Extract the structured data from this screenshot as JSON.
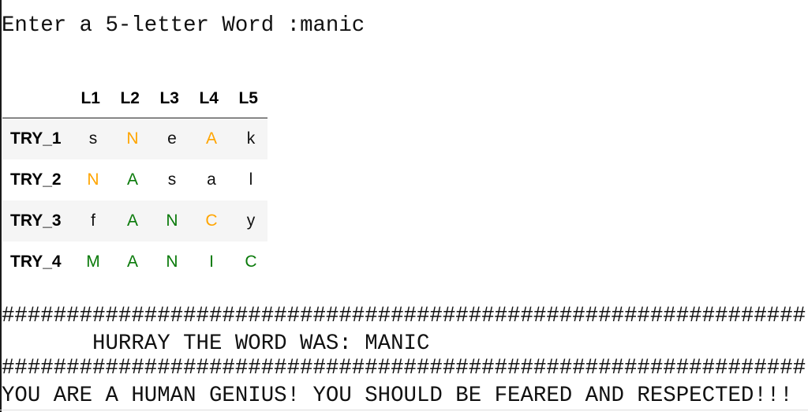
{
  "prompt": {
    "label": "Enter a 5-letter Word :",
    "value": "manic"
  },
  "table": {
    "columns": [
      "L1",
      "L2",
      "L3",
      "L4",
      "L5"
    ],
    "status_colors": {
      "absent": "#111111",
      "present": "#ffa500",
      "correct": "#0a7a0a"
    },
    "rows": [
      {
        "label": "TRY_1",
        "cells": [
          {
            "letter": "s",
            "status": "absent"
          },
          {
            "letter": "N",
            "status": "present"
          },
          {
            "letter": "e",
            "status": "absent"
          },
          {
            "letter": "A",
            "status": "present"
          },
          {
            "letter": "k",
            "status": "absent"
          }
        ]
      },
      {
        "label": "TRY_2",
        "cells": [
          {
            "letter": "N",
            "status": "present"
          },
          {
            "letter": "A",
            "status": "correct"
          },
          {
            "letter": "s",
            "status": "absent"
          },
          {
            "letter": "a",
            "status": "absent"
          },
          {
            "letter": "l",
            "status": "absent"
          }
        ]
      },
      {
        "label": "TRY_3",
        "cells": [
          {
            "letter": "f",
            "status": "absent"
          },
          {
            "letter": "A",
            "status": "correct"
          },
          {
            "letter": "N",
            "status": "correct"
          },
          {
            "letter": "C",
            "status": "present"
          },
          {
            "letter": "y",
            "status": "absent"
          }
        ]
      },
      {
        "label": "TRY_4",
        "cells": [
          {
            "letter": "M",
            "status": "correct"
          },
          {
            "letter": "A",
            "status": "correct"
          },
          {
            "letter": "N",
            "status": "correct"
          },
          {
            "letter": "I",
            "status": "correct"
          },
          {
            "letter": "C",
            "status": "correct"
          }
        ]
      }
    ]
  },
  "result": {
    "separator": "##############################################################",
    "hurray_text": "       HURRAY THE WORD WAS: MANIC",
    "genius_text": "YOU ARE A HUMAN GENIUS! YOU SHOULD BE FEARED AND RESPECTED!!!"
  }
}
